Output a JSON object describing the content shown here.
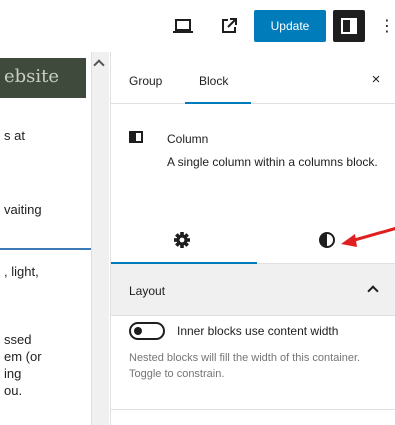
{
  "toolbar": {
    "preview_icon": "laptop-icon",
    "external_icon": "external-link-icon",
    "update_label": "Update",
    "settings_icon": "sidebar-panel-icon",
    "options_icon": "more-vertical-icon",
    "options_glyph": "⋮"
  },
  "editor": {
    "image_text": "ebsite",
    "lines": [
      "s at",
      "vaiting",
      ", light,",
      "ssed",
      "em (or",
      "ing",
      "ou."
    ]
  },
  "sidebar": {
    "tabs": [
      {
        "label": "Group"
      },
      {
        "label": "Block"
      }
    ],
    "close_glyph": "×",
    "block": {
      "icon": "column-icon",
      "title": "Column",
      "description": "A single column within a columns block."
    },
    "subtabs": [
      {
        "icon": "gear-icon"
      },
      {
        "icon": "half-circle-styles-icon"
      }
    ],
    "layout": {
      "title": "Layout",
      "toggle_label": "Inner blocks use content width",
      "toggle_checked": false,
      "help": "Nested blocks will fill the width of this container. Toggle to constrain."
    }
  },
  "colors": {
    "accent": "#007cba",
    "annotation_arrow": "#e02020"
  }
}
